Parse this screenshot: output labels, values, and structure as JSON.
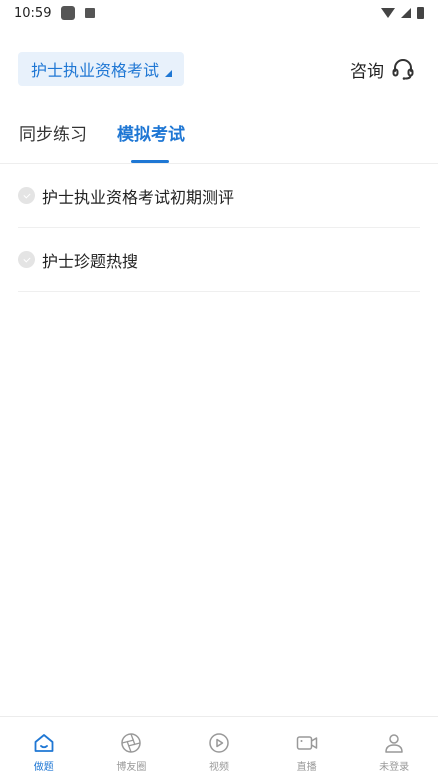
{
  "status_bar": {
    "time": "10:59"
  },
  "header": {
    "exam_selector_label": "护士执业资格考试",
    "consult_label": "咨询"
  },
  "tabs": [
    {
      "label": "同步练习",
      "active": false
    },
    {
      "label": "模拟考试",
      "active": true
    }
  ],
  "list": [
    {
      "label": "护士执业资格考试初期测评"
    },
    {
      "label": "护士珍题热搜"
    }
  ],
  "tabbar": [
    {
      "label": "做题",
      "icon": "home-icon",
      "active": true
    },
    {
      "label": "博友圈",
      "icon": "aperture-icon",
      "active": false
    },
    {
      "label": "视频",
      "icon": "play-icon",
      "active": false
    },
    {
      "label": "直播",
      "icon": "camera-icon",
      "active": false
    },
    {
      "label": "未登录",
      "icon": "user-icon",
      "active": false
    }
  ],
  "colors": {
    "accent": "#1f77d4",
    "selector_bg": "#e8f1fb"
  }
}
